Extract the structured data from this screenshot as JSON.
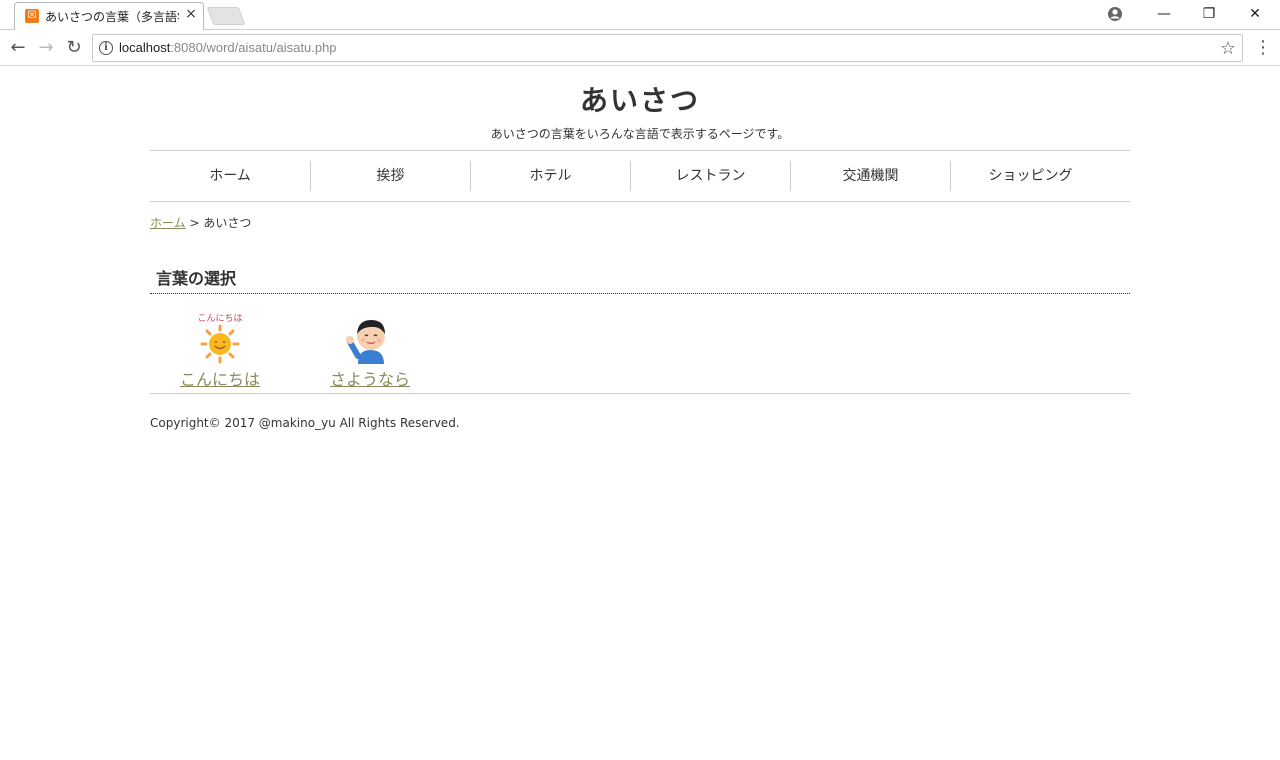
{
  "browser": {
    "tab_title": "あいさつの言葉（多言語学",
    "tab_close": "×",
    "url_host": "localhost",
    "url_rest": ":8080/word/aisatu/aisatu.php"
  },
  "site": {
    "title": "あいさつ",
    "description": "あいさつの言葉をいろんな言語で表示するページです。"
  },
  "nav": {
    "items": [
      {
        "label": "ホーム"
      },
      {
        "label": "挨拶"
      },
      {
        "label": "ホテル"
      },
      {
        "label": "レストラン"
      },
      {
        "label": "交通機関"
      },
      {
        "label": "ショッピング"
      }
    ]
  },
  "breadcrumb": {
    "home": "ホーム",
    "separator": ">",
    "current": "あいさつ"
  },
  "section": {
    "title": "言葉の選択"
  },
  "choices": [
    {
      "label": "こんにちは",
      "icon": "sun-icon",
      "pic_text": "こんにちは"
    },
    {
      "label": "さようなら",
      "icon": "waving-boy-icon"
    }
  ],
  "footer": {
    "copyright": "Copyright© 2017 @makino_yu All Rights Reserved."
  },
  "colors": {
    "link": "#8a8a5c",
    "border": "#cfcfcf",
    "text": "#333333"
  }
}
